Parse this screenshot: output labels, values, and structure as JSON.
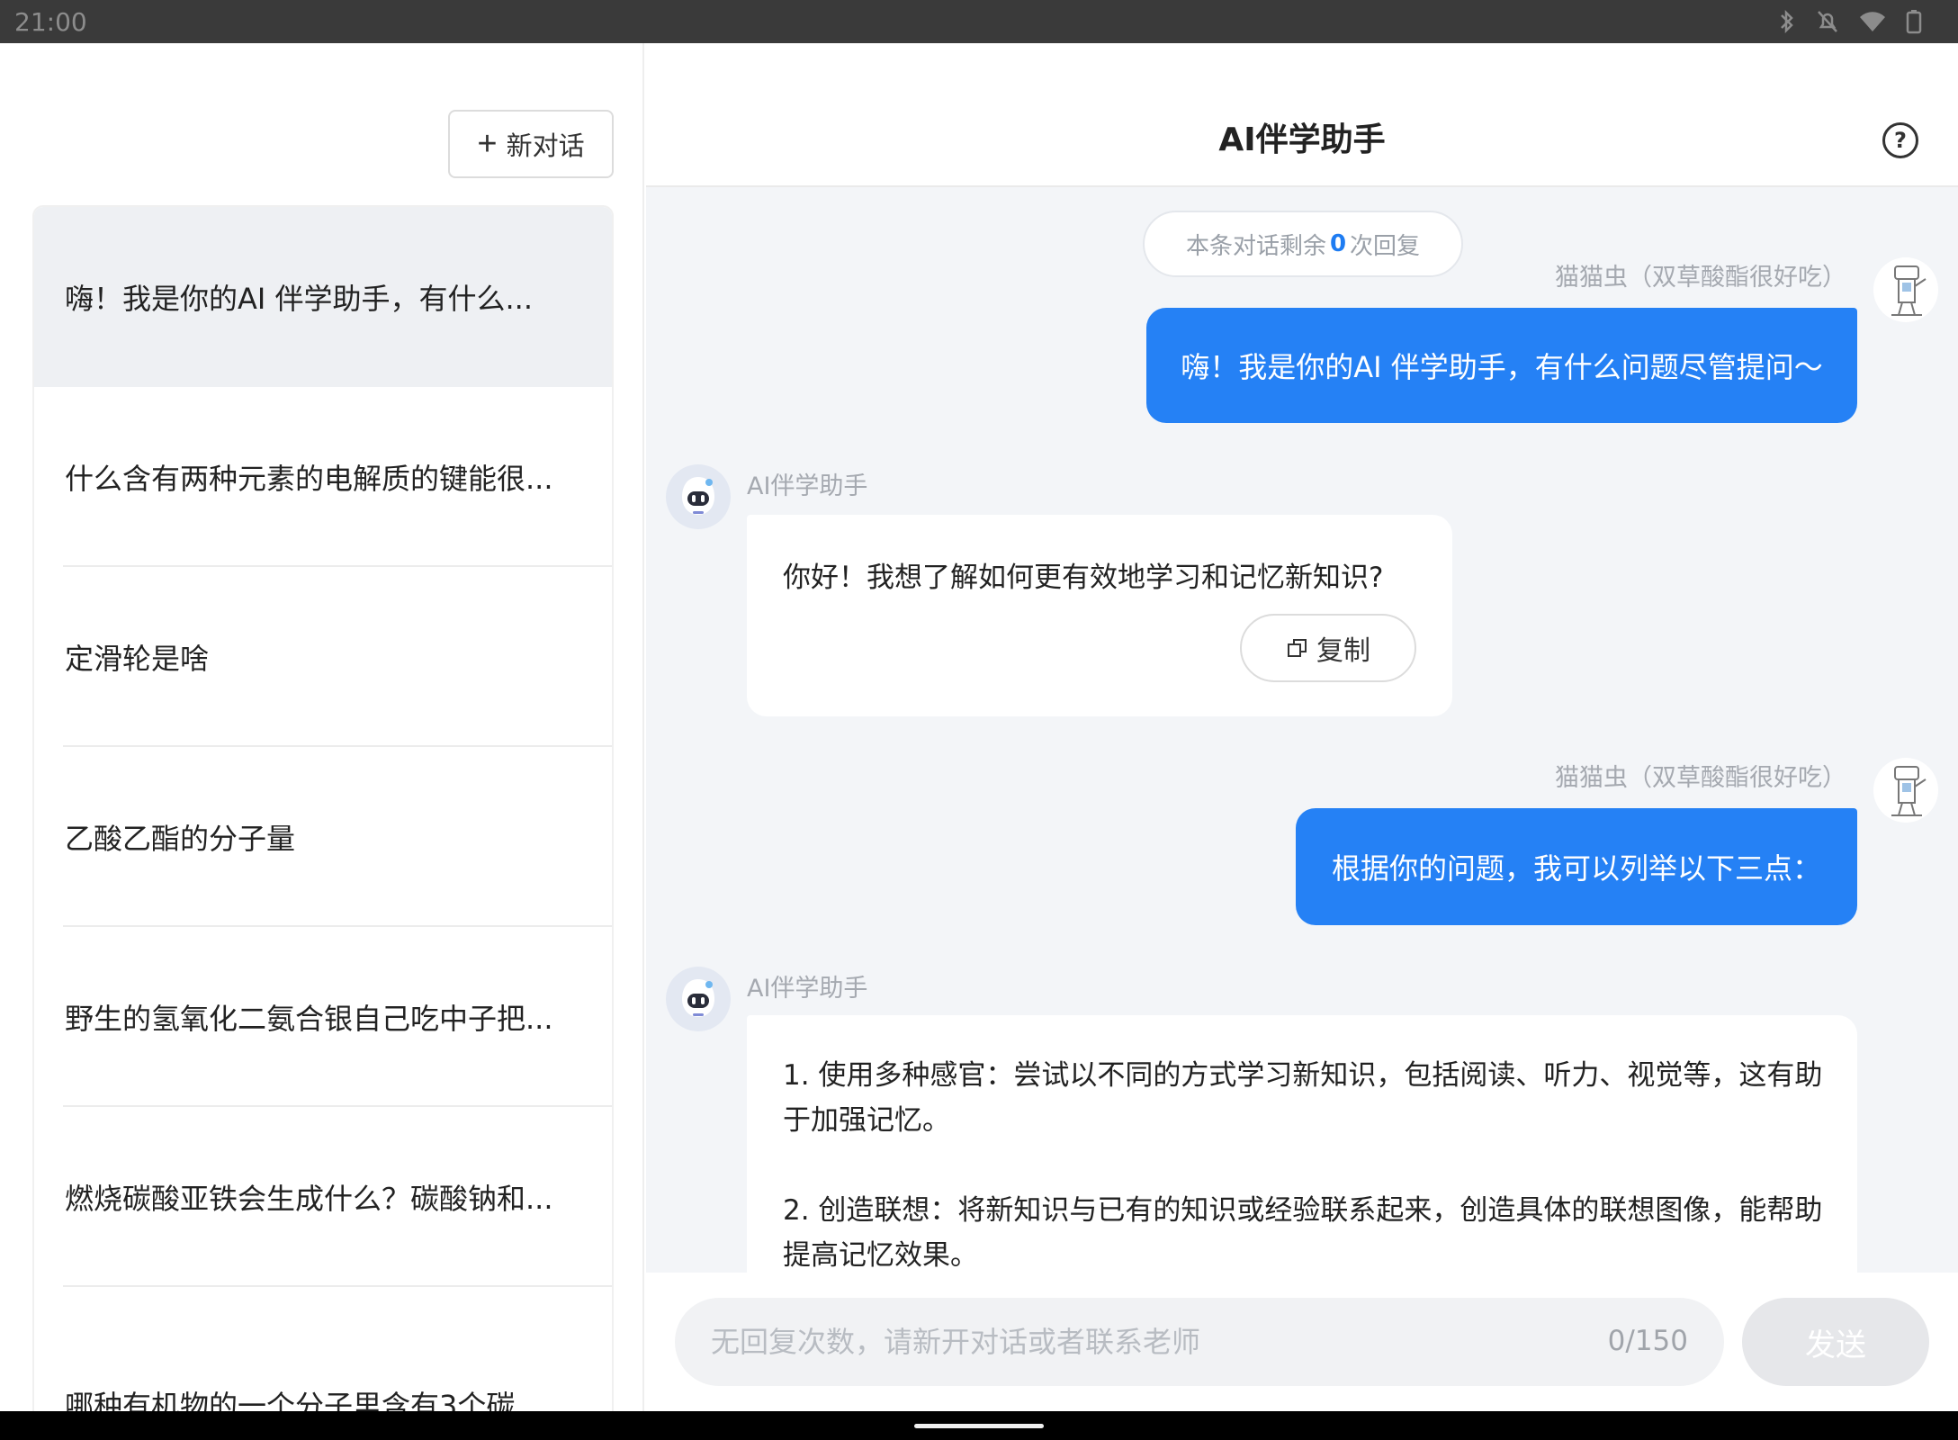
{
  "status_bar": {
    "time": "21:00"
  },
  "sidebar": {
    "new_chat_label": "新对话",
    "conversations": [
      "嗨！我是你的AI 伴学助手，有什么...",
      "什么含有两种元素的电解质的键能很...",
      "定滑轮是啥",
      "乙酸乙酯的分子量",
      "野生的氢氧化二氨合银自己吃中子把...",
      "燃烧碳酸亚铁会生成什么？碳酸钠和...",
      "哪种有机物的一个分子里含有3个碳..."
    ]
  },
  "header": {
    "title": "AI伴学助手",
    "help_symbol": "?"
  },
  "remaining": {
    "prefix": "本条对话剩余",
    "count": "0",
    "suffix": "次回复"
  },
  "messages": [
    {
      "role": "user",
      "name": "猫猫虫（双草酸酯很好吃）",
      "text": "嗨！我是你的AI 伴学助手，有什么问题尽管提问～"
    },
    {
      "role": "ai",
      "name": "AI伴学助手",
      "text": "你好！我想了解如何更有效地学习和记忆新知识?",
      "copy_label": "复制"
    },
    {
      "role": "user",
      "name": "猫猫虫（双草酸酯很好吃）",
      "text": "根据你的问题，我可以列举以下三点："
    },
    {
      "role": "ai",
      "name": "AI伴学助手",
      "paragraphs": [
        "1. 使用多种感官：尝试以不同的方式学习新知识，包括阅读、听力、视觉等，这有助于加强记忆。",
        "2. 创造联想：将新知识与已有的知识或经验联系起来，创造具体的联想图像，能帮助提高记忆效果。"
      ]
    }
  ],
  "input": {
    "placeholder": "无回复次数，请新开对话或者联系老师",
    "counter": "0/150",
    "send_label": "发送"
  },
  "colors": {
    "accent": "#2581f5",
    "user_bubble": "#2581f5",
    "chat_bg": "#f3f5f8",
    "send_disabled": "#e6e7ea"
  }
}
